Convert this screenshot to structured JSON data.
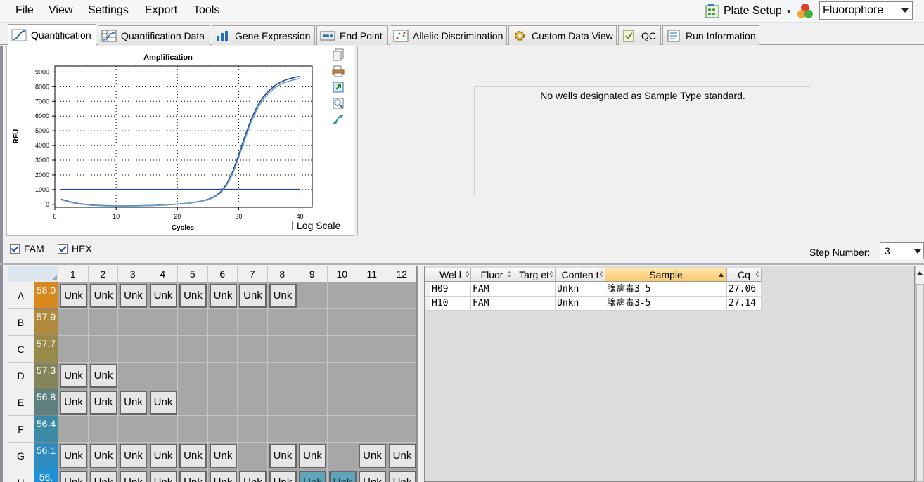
{
  "menu": {
    "file": "File",
    "view": "View",
    "settings": "Settings",
    "export": "Export",
    "tools": "Tools"
  },
  "plate_setup": "Plate Setup",
  "fluorophore": "Fluorophore",
  "tabs": [
    {
      "label": "Quantification",
      "icon": "amplification-curve-icon"
    },
    {
      "label": "Quantification Data",
      "icon": "data-table-icon"
    },
    {
      "label": "Gene Expression",
      "icon": "bar-chart-icon"
    },
    {
      "label": "End Point",
      "icon": "endpoint-icon"
    },
    {
      "label": "Allelic Discrimination",
      "icon": "scatter-plot-icon"
    },
    {
      "label": "Custom Data View",
      "icon": "gear-icon"
    },
    {
      "label": "QC",
      "icon": "qc-checklist-icon"
    },
    {
      "label": "Run Information",
      "icon": "report-icon"
    }
  ],
  "chart_data": {
    "type": "line",
    "title": "Amplification",
    "xlabel": "Cycles",
    "ylabel": "RFU",
    "xlim": [
      0,
      42
    ],
    "ylim": [
      -200,
      9400
    ],
    "xticks": [
      0,
      10,
      20,
      30,
      40
    ],
    "yticks": [
      0,
      1000,
      2000,
      3000,
      4000,
      5000,
      6000,
      7000,
      8000,
      9000
    ],
    "grid": true,
    "threshold": 1000,
    "series": [
      {
        "well": "H09",
        "color": "#1f4f8a",
        "x": [
          1,
          2,
          3,
          4,
          5,
          6,
          8,
          10,
          12,
          14,
          16,
          18,
          20,
          22,
          24,
          25,
          26,
          27,
          28,
          29,
          30,
          31,
          32,
          33,
          34,
          35,
          36,
          37,
          38,
          39,
          40
        ],
        "y": [
          350,
          230,
          120,
          50,
          0,
          -40,
          -80,
          -100,
          -100,
          -90,
          -70,
          -30,
          20,
          90,
          230,
          340,
          520,
          820,
          1350,
          2200,
          3350,
          4600,
          5750,
          6650,
          7300,
          7750,
          8100,
          8350,
          8500,
          8620,
          8700
        ]
      },
      {
        "well": "H10",
        "color": "#6c9ec7",
        "x": [
          1,
          2,
          3,
          4,
          5,
          6,
          8,
          10,
          12,
          14,
          16,
          18,
          20,
          22,
          24,
          25,
          26,
          27,
          28,
          29,
          30,
          31,
          32,
          33,
          34,
          35,
          36,
          37,
          38,
          39,
          40
        ],
        "y": [
          320,
          200,
          100,
          30,
          -20,
          -60,
          -100,
          -110,
          -110,
          -100,
          -80,
          -40,
          10,
          80,
          210,
          310,
          480,
          760,
          1250,
          2050,
          3150,
          4400,
          5550,
          6450,
          7150,
          7600,
          7950,
          8200,
          8350,
          8470,
          8550
        ]
      }
    ]
  },
  "log_scale": "Log Scale",
  "std_message": "No wells designated as Sample Type standard.",
  "series_toggles": [
    {
      "label": "FAM",
      "checked": true
    },
    {
      "label": "HEX",
      "checked": true
    }
  ],
  "step_label": "Step Number:",
  "step_value": "3",
  "plate": {
    "columns": [
      "1",
      "2",
      "3",
      "4",
      "5",
      "6",
      "7",
      "8",
      "9",
      "10",
      "11",
      "12"
    ],
    "rows": [
      {
        "row": "A",
        "temp": "58.0",
        "color": "#d9881e",
        "wells": [
          1,
          2,
          3,
          4,
          5,
          6,
          7,
          8
        ]
      },
      {
        "row": "B",
        "temp": "57.9",
        "color": "#b08a3c",
        "wells": []
      },
      {
        "row": "C",
        "temp": "57.7",
        "color": "#9a8a4a",
        "wells": []
      },
      {
        "row": "D",
        "temp": "57.3",
        "color": "#85855a",
        "wells": [
          1,
          2
        ]
      },
      {
        "row": "E",
        "temp": "56.8",
        "color": "#5f8080",
        "wells": [
          1,
          2,
          3,
          4
        ]
      },
      {
        "row": "F",
        "temp": "56.4",
        "color": "#3d8aa5",
        "wells": []
      },
      {
        "row": "G",
        "temp": "56.1",
        "color": "#2f8cc2",
        "wells": [
          1,
          2,
          3,
          4,
          5,
          6,
          8,
          9,
          11,
          12
        ]
      },
      {
        "row": "H",
        "temp": "56.",
        "color": "#1e90d8",
        "wells": [
          1,
          2,
          3,
          4,
          5,
          6,
          7,
          8,
          9,
          10,
          11,
          12
        ],
        "selected": [
          9,
          10
        ]
      }
    ],
    "well_label": "Unk"
  },
  "grid_headers": [
    {
      "label": "Wel l",
      "w": 58
    },
    {
      "label": "Fluor",
      "w": 60
    },
    {
      "label": "Targ et",
      "w": 60
    },
    {
      "label": "Conten t",
      "w": 71
    },
    {
      "label": "Sample",
      "w": 173,
      "sorted": true
    },
    {
      "label": "Cq",
      "w": 49
    }
  ],
  "grid_rows": [
    {
      "well": "H09",
      "fluor": "FAM",
      "target": "",
      "content": "Unkn",
      "sample": "腺病毒3-5",
      "cq": "27.06"
    },
    {
      "well": "H10",
      "fluor": "FAM",
      "target": "",
      "content": "Unkn",
      "sample": "腺病毒3-5",
      "cq": "27.14"
    }
  ]
}
